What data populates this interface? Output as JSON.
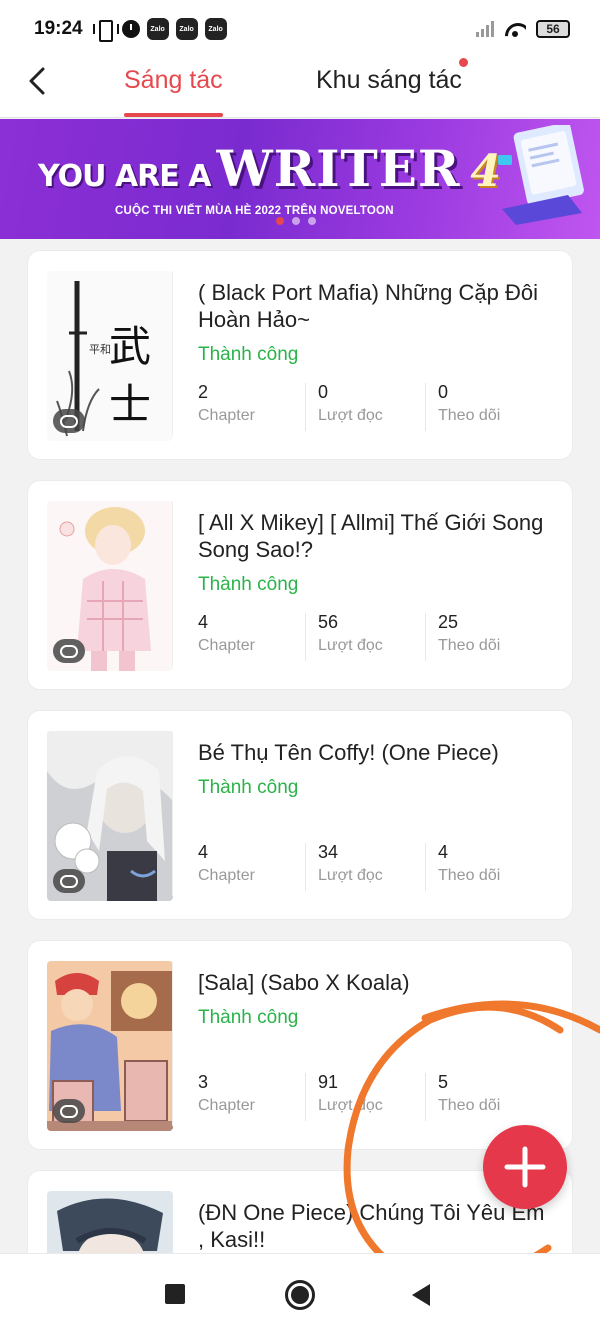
{
  "status_bar": {
    "time": "19:24",
    "notification_icons": [
      "vibrate-icon",
      "clock-icon",
      "zalo-icon",
      "zalo-icon",
      "zalo-icon"
    ],
    "zalo_label": "Zalo",
    "battery": "56"
  },
  "header": {
    "tabs": [
      {
        "label": "Sáng tác",
        "active": true
      },
      {
        "label": "Khu sáng tác",
        "active": false,
        "has_notification_dot": true
      }
    ]
  },
  "banner": {
    "title_prefix": "YOU ARE A",
    "title_main": "WRITER",
    "title_number": "4",
    "subtitle": "CUỘC THI VIẾT MÙA HÈ 2022 TRÊN NOVELTOON",
    "pages": 3,
    "active_page": 1
  },
  "works": [
    {
      "title": "( Black Port Mafia) Những Cặp Đôi Hoàn Hảo~",
      "status": "Thành công",
      "stats": [
        {
          "value": "2",
          "label": "Chapter"
        },
        {
          "value": "0",
          "label": "Lượt đọc"
        },
        {
          "value": "0",
          "label": "Theo dõi"
        }
      ]
    },
    {
      "title": "[ All X Mikey] [ Allmi] Thế Giới Song Song Sao!?",
      "status": "Thành công",
      "stats": [
        {
          "value": "4",
          "label": "Chapter"
        },
        {
          "value": "56",
          "label": "Lượt đọc"
        },
        {
          "value": "25",
          "label": "Theo dõi"
        }
      ]
    },
    {
      "title": "Bé Thụ Tên Coffy! (One Piece)",
      "status": "Thành công",
      "stats": [
        {
          "value": "4",
          "label": "Chapter"
        },
        {
          "value": "34",
          "label": "Lượt đọc"
        },
        {
          "value": "4",
          "label": "Theo dõi"
        }
      ]
    },
    {
      "title": "[Sala] (Sabo X Koala)",
      "status": "Thành công",
      "stats": [
        {
          "value": "3",
          "label": "Chapter"
        },
        {
          "value": "91",
          "label": "Lượt đọc"
        },
        {
          "value": "5",
          "label": "Theo dõi"
        }
      ]
    },
    {
      "title": "(ĐN One Piece) Chúng Tôi Yêu Em , Kasi!!",
      "status": "",
      "stats": []
    }
  ],
  "fab": {
    "icon": "plus-icon"
  },
  "nav_bar": {
    "icons": [
      "recents-square-icon",
      "home-circle-icon",
      "back-triangle-icon"
    ]
  },
  "colors": {
    "accent": "#e5484d",
    "success": "#2bb34a",
    "fab": "#e5384a",
    "annotation": "#f0782d",
    "banner": "#8c2fd6"
  }
}
